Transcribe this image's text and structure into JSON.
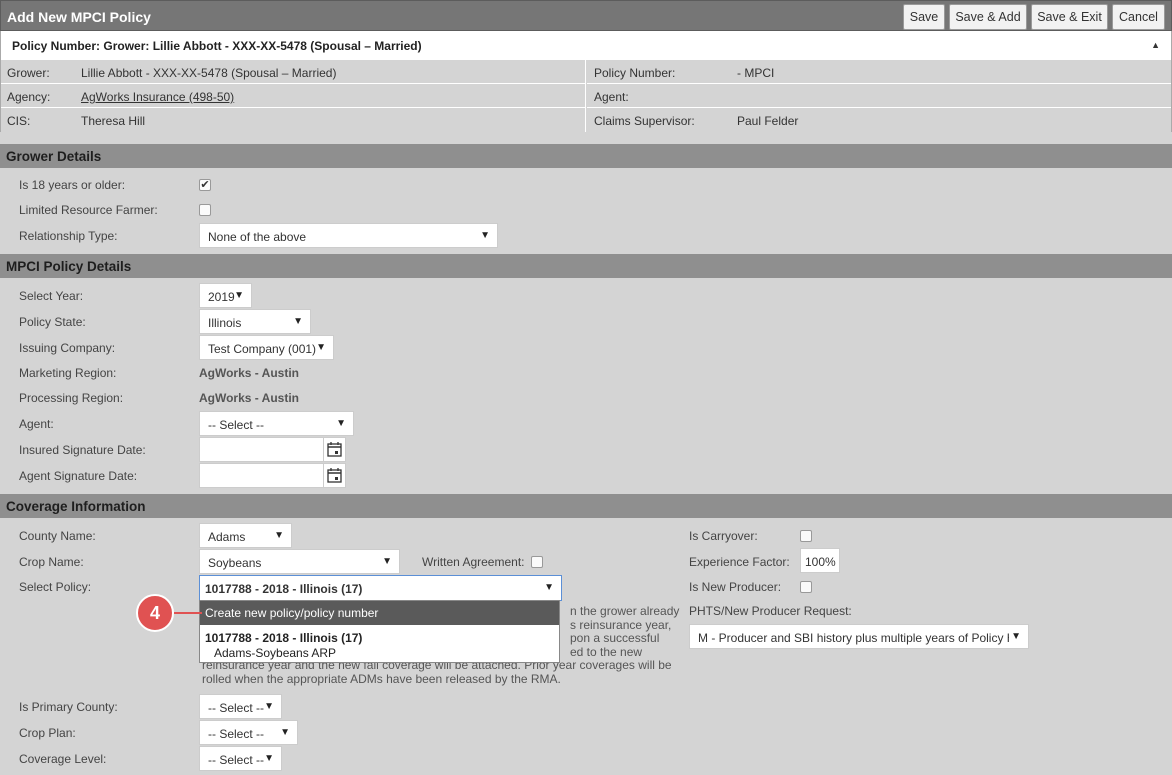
{
  "window": {
    "title": "Add New MPCI Policy",
    "buttons": [
      "Save",
      "Save & Add",
      "Save & Exit",
      "Cancel"
    ]
  },
  "policy_bar": {
    "text": "Policy Number: Grower: Lillie Abbott - XXX-XX-5478 (Spousal – Married)",
    "caret": "▲"
  },
  "info": {
    "grower_label": "Grower:",
    "grower_value": "Lillie Abbott - XXX-XX-5478 (Spousal – Married)",
    "agency_label": "Agency:",
    "agency_value": "AgWorks Insurance (498-50)",
    "cis_label": "CIS:",
    "cis_value": "Theresa Hill",
    "policy_number_label": "Policy Number:",
    "policy_number_value": "- MPCI",
    "agent_label": "Agent:",
    "agent_value": "",
    "claims_supervisor_label": "Claims Supervisor:",
    "claims_supervisor_value": "Paul Felder"
  },
  "grower_details": {
    "heading": "Grower Details",
    "age_label": "Is 18 years or older:",
    "age_checked": true,
    "lrf_label": "Limited Resource Farmer:",
    "lrf_checked": false,
    "relationship_label": "Relationship Type:",
    "relationship_value": "None of the above"
  },
  "mpci_details": {
    "heading": "MPCI Policy Details",
    "year_label": "Select Year:",
    "year_value": "2019",
    "state_label": "Policy State:",
    "state_value": "Illinois",
    "company_label": "Issuing Company:",
    "company_value": "Test Company (001)",
    "marketing_label": "Marketing Region:",
    "marketing_value": "AgWorks - Austin",
    "processing_label": "Processing Region:",
    "processing_value": "AgWorks - Austin",
    "agent_label": "Agent:",
    "agent_value": "-- Select --",
    "insured_sig_label": "Insured Signature Date:",
    "agent_sig_label": "Agent Signature Date:"
  },
  "coverage": {
    "heading": "Coverage Information",
    "county_label": "County Name:",
    "county_value": "Adams",
    "crop_label": "Crop Name:",
    "crop_value": "Soybeans",
    "written_label": "Written Agreement:",
    "policy_label": "Select Policy:",
    "policy_value": "1017788 - 2018 - Illinois (17)",
    "dropdown_create": "Create new policy/policy number",
    "dropdown_opt_title": "1017788 - 2018 - Illinois (17)",
    "dropdown_opt_sub": "Adams-Soybeans ARP",
    "note_line1": "n the grower already",
    "note_line2": "s reinsurance year,",
    "note_line3": "pon a successful",
    "note_line4": "ed to the new",
    "note_line5": "reinsurance year and the new fall coverage will be attached. Prior year coverages will be",
    "note_line6": "rolled when the appropriate ADMs have been released by the RMA.",
    "primary_label": "Is Primary County:",
    "primary_value": "-- Select --",
    "plan_label": "Crop Plan:",
    "plan_value": "-- Select --",
    "level_label": "Coverage Level:",
    "level_value": "-- Select --",
    "carryover_label": "Is Carryover:",
    "exp_label": "Experience Factor:",
    "exp_value": "100%",
    "new_producer_label": "Is New Producer:",
    "phts_label": "PHTS/New Producer Request:",
    "phts_value": "M - Producer and SBI history plus multiple years of Policy H"
  },
  "badge": "4"
}
